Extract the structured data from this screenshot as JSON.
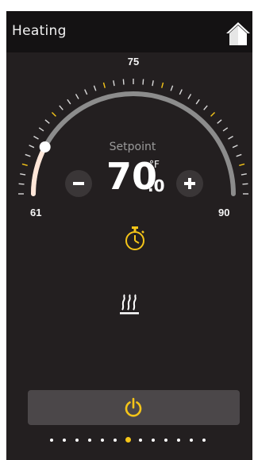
{
  "header": {
    "title": "Heating",
    "home_icon": "home-icon"
  },
  "thermostat": {
    "setpoint_label": "Setpoint",
    "setpoint_whole": "70",
    "setpoint_decimal": ".0",
    "unit": "°F",
    "min": 61,
    "max": 90,
    "mid_label": "75",
    "min_label": "61",
    "max_label": "90",
    "current_setpoint": 70,
    "knob_value": 65.5,
    "decrease_label": "−",
    "increase_label": "+"
  },
  "icons": {
    "timer": "timer-icon",
    "mode": "heat-mode-icon",
    "power": "power-icon"
  },
  "pager": {
    "count": 13,
    "active_index": 6
  },
  "colors": {
    "accent": "#f5c518",
    "arc_active": "#ffe6d8",
    "arc_track": "#8c8c8c",
    "background": "#231f20",
    "titlebar": "#141213"
  }
}
